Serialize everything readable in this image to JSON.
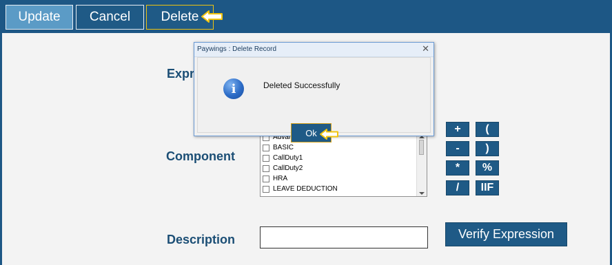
{
  "toolbar": {
    "update_label": "Update",
    "cancel_label": "Cancel",
    "delete_label": "Delete"
  },
  "form": {
    "expression_label_partial": "Expr",
    "component_label": "Component",
    "description_label": "Description",
    "description_value": "",
    "verify_label": "Verify Expression",
    "components": [
      {
        "label": "Advance2",
        "checked": false
      },
      {
        "label": "BASIC",
        "checked": false
      },
      {
        "label": "CallDuty1",
        "checked": false
      },
      {
        "label": "CallDuty2",
        "checked": false
      },
      {
        "label": "HRA",
        "checked": false
      },
      {
        "label": "LEAVE DEDUCTION",
        "checked": false
      }
    ],
    "operators": [
      "+",
      "(",
      "-",
      ")",
      "*",
      "%",
      "/",
      "IIF"
    ]
  },
  "dialog": {
    "title": "Paywings : Delete Record",
    "message": "Deleted Successfully",
    "ok_label": "Ok",
    "icon": "info-icon"
  },
  "colors": {
    "toolbar_bg": "#1d5785",
    "button_bg": "#1f5a86",
    "highlight": "#f1c40f",
    "label_color": "#1b4e75"
  }
}
